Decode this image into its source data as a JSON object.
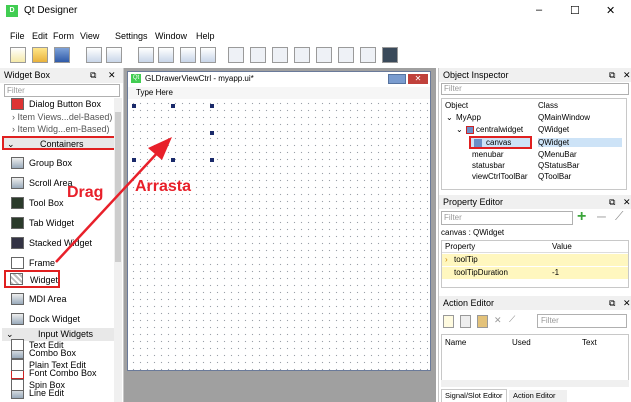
{
  "window": {
    "title": "Qt Designer",
    "app_icon": "qt-designer-icon",
    "controls": [
      "–",
      "☐",
      "✕"
    ]
  },
  "menu": [
    "File",
    "Edit",
    "Form",
    "View",
    "Settings",
    "Window",
    "Help"
  ],
  "widget_box": {
    "title": "Widget Box",
    "filter_placeholder": "Filter",
    "items": [
      {
        "kind": "item",
        "label": "Dialog Button Box"
      },
      {
        "kind": "cat",
        "label": "Item Views...del-Based)"
      },
      {
        "kind": "cat",
        "label": "Item Widg...em-Based)"
      },
      {
        "kind": "section",
        "label": "Containers"
      },
      {
        "kind": "item",
        "label": "Group Box"
      },
      {
        "kind": "item",
        "label": "Scroll Area"
      },
      {
        "kind": "item",
        "label": "Tool Box"
      },
      {
        "kind": "item",
        "label": "Tab Widget"
      },
      {
        "kind": "item",
        "label": "Stacked Widget"
      },
      {
        "kind": "item",
        "label": "Frame"
      },
      {
        "kind": "item",
        "label": "Widget"
      },
      {
        "kind": "item",
        "label": "MDI Area"
      },
      {
        "kind": "item",
        "label": "Dock Widget"
      },
      {
        "kind": "section",
        "label": "Input Widgets"
      },
      {
        "kind": "item",
        "label": "Combo Box"
      },
      {
        "kind": "item",
        "label": "Font Combo Box"
      },
      {
        "kind": "item",
        "label": "Line Edit"
      },
      {
        "kind": "item",
        "label": "Text Edit"
      },
      {
        "kind": "item",
        "label": "Plain Text Edit"
      },
      {
        "kind": "item",
        "label": "Spin Box"
      }
    ]
  },
  "form_window": {
    "title": "GLDrawerViewCtrl - myapp.ui*",
    "menu_placeholder": "Type Here"
  },
  "annotations": {
    "drag": "Drag",
    "arrasta": "Arrasta",
    "color": "#e8202a"
  },
  "object_inspector": {
    "title": "Object Inspector",
    "filter_placeholder": "Filter",
    "columns": [
      "Object",
      "Class"
    ],
    "rows": [
      {
        "object": "MyApp",
        "class": "QMainWindow",
        "indent": 1
      },
      {
        "object": "centralwidget",
        "class": "QWidget",
        "indent": 2
      },
      {
        "object": "canvas",
        "class": "QWidget",
        "indent": 3
      },
      {
        "object": "menubar",
        "class": "QMenuBar",
        "indent": 2
      },
      {
        "object": "statusbar",
        "class": "QStatusBar",
        "indent": 2
      },
      {
        "object": "viewCtrlToolBar",
        "class": "QToolBar",
        "indent": 2
      }
    ]
  },
  "property_editor": {
    "title": "Property Editor",
    "filter_placeholder": "Filter",
    "context": "canvas : QWidget",
    "columns": [
      "Property",
      "Value"
    ],
    "rows": [
      {
        "property": "toolTip",
        "value": ""
      },
      {
        "property": "toolTipDuration",
        "value": "-1"
      }
    ]
  },
  "action_editor": {
    "title": "Action Editor",
    "filter_placeholder": "Filter",
    "columns": [
      "Name",
      "Used",
      "Text"
    ]
  },
  "bottom_tabs": [
    "Signal/Slot Editor",
    "Action Editor"
  ]
}
